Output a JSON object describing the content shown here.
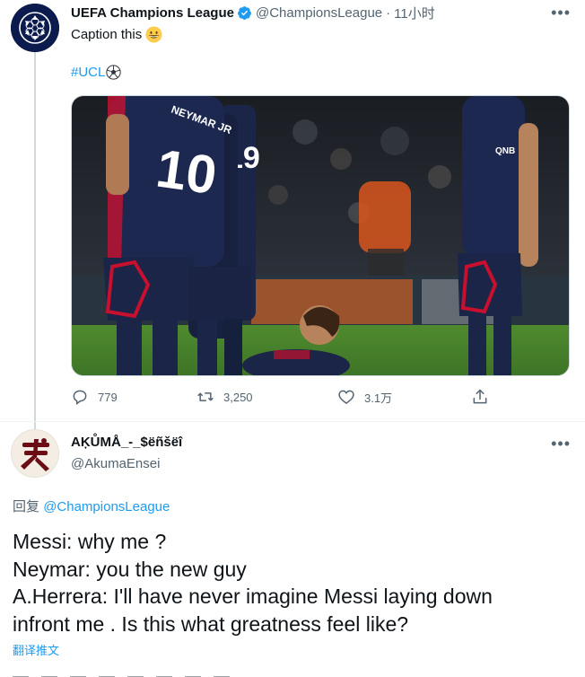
{
  "tweet": {
    "author_name": "UEFA Champions League",
    "handle": "@ChampionsLeague",
    "dot": "·",
    "time": "11小时",
    "more": "•••",
    "text": "Caption this",
    "hashtag": "#UCL",
    "media": {
      "jersey_name": "NEYMAR JR",
      "number_left": "10",
      "number_right": "19",
      "sponsor": "QNB"
    },
    "actions": {
      "replies": "779",
      "retweets": "3,250",
      "likes": "3.1万"
    }
  },
  "reply": {
    "author_name": "AĶŮMÅ_-_$ëñšëî",
    "handle": "@AkumaEnsei",
    "more": "•••",
    "replying_prefix": "回复",
    "replying_to": "@ChampionsLeague",
    "lines": [
      "Messi: why me ?",
      "Neymar: you the new guy",
      "A.Herrera: I'll have never imagine Messi laying down",
      "infront me . Is this what greatness feel like?"
    ],
    "translate_label": "翻译推文"
  },
  "colors": {
    "accent": "#1d9bf0",
    "secondary_text": "#536471",
    "primary_text": "#0f1419",
    "divider": "#eff3f4"
  },
  "icons": {
    "verified": "verified-badge-icon",
    "reply": "reply-icon",
    "retweet": "retweet-icon",
    "like": "heart-icon",
    "share": "share-icon",
    "more": "more-icon",
    "emoji": "grinning-face-icon",
    "ball": "soccer-ball-icon"
  }
}
